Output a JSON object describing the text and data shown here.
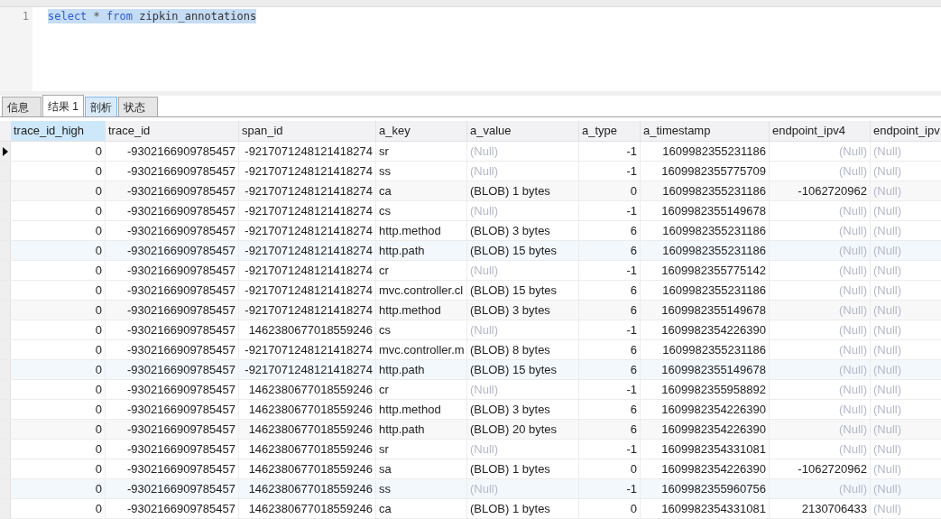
{
  "editor": {
    "lines": [
      {
        "number": "1",
        "selected": true,
        "tokens": [
          {
            "text": "select",
            "kind": "keyword"
          },
          {
            "text": "*",
            "kind": "operator"
          },
          {
            "text": "from",
            "kind": "keyword"
          },
          {
            "text": "zipkin_annotations",
            "kind": "identifier"
          }
        ]
      }
    ]
  },
  "tabs": [
    {
      "label": "信息",
      "selected": false,
      "hovered": false
    },
    {
      "label": "结果 1",
      "selected": true,
      "hovered": false
    },
    {
      "label": "剖析",
      "selected": false,
      "hovered": true
    },
    {
      "label": "状态",
      "selected": false,
      "hovered": false
    }
  ],
  "table": {
    "columns": [
      {
        "label": "trace_id_high",
        "kind": "number",
        "selected": true
      },
      {
        "label": "trace_id",
        "kind": "number",
        "selected": false
      },
      {
        "label": "span_id",
        "kind": "number",
        "selected": false
      },
      {
        "label": "a_key",
        "kind": "text",
        "selected": false
      },
      {
        "label": "a_value",
        "kind": "text",
        "selected": false
      },
      {
        "label": "a_type",
        "kind": "number",
        "selected": false
      },
      {
        "label": "a_timestamp",
        "kind": "number",
        "selected": false
      },
      {
        "label": "endpoint_ipv4",
        "kind": "number",
        "selected": false
      },
      {
        "label": "endpoint_ipv",
        "kind": "text",
        "selected": false
      }
    ],
    "rows": [
      {
        "current": true,
        "highlighted": false,
        "cells": [
          "0",
          "-9302166909785457",
          "-9217071248121418274",
          "sr",
          {
            "text": "(Null)",
            "kind": "null"
          },
          "-1",
          "1609982355231186",
          {
            "text": "(Null)",
            "kind": "null"
          },
          {
            "text": "(Null)",
            "kind": "null"
          }
        ]
      },
      {
        "current": false,
        "highlighted": false,
        "cells": [
          "0",
          "-9302166909785457",
          "-9217071248121418274",
          "ss",
          {
            "text": "(Null)",
            "kind": "null"
          },
          "-1",
          "1609982355775709",
          {
            "text": "(Null)",
            "kind": "null"
          },
          {
            "text": "(Null)",
            "kind": "null"
          }
        ]
      },
      {
        "current": false,
        "highlighted": false,
        "cells": [
          "0",
          "-9302166909785457",
          "-9217071248121418274",
          "ca",
          "(BLOB) 1 bytes",
          "0",
          "1609982355231186",
          "-1062720962",
          {
            "text": "(Null)",
            "kind": "null"
          }
        ]
      },
      {
        "current": false,
        "highlighted": false,
        "cells": [
          "0",
          "-9302166909785457",
          "-9217071248121418274",
          "cs",
          {
            "text": "(Null)",
            "kind": "null"
          },
          "-1",
          "1609982355149678",
          {
            "text": "(Null)",
            "kind": "null"
          },
          {
            "text": "(Null)",
            "kind": "null"
          }
        ]
      },
      {
        "current": false,
        "highlighted": false,
        "cells": [
          "0",
          "-9302166909785457",
          "-9217071248121418274",
          "http.method",
          "(BLOB) 3 bytes",
          "6",
          "1609982355231186",
          {
            "text": "(Null)",
            "kind": "null"
          },
          {
            "text": "(Null)",
            "kind": "null"
          }
        ]
      },
      {
        "current": false,
        "highlighted": true,
        "cells": [
          "0",
          "-9302166909785457",
          "-9217071248121418274",
          "http.path",
          "(BLOB) 15 bytes",
          "6",
          "1609982355231186",
          {
            "text": "(Null)",
            "kind": "null"
          },
          {
            "text": "(Null)",
            "kind": "null"
          }
        ]
      },
      {
        "current": false,
        "highlighted": false,
        "cells": [
          "0",
          "-9302166909785457",
          "-9217071248121418274",
          "cr",
          {
            "text": "(Null)",
            "kind": "null"
          },
          "-1",
          "1609982355775142",
          {
            "text": "(Null)",
            "kind": "null"
          },
          {
            "text": "(Null)",
            "kind": "null"
          }
        ]
      },
      {
        "current": false,
        "highlighted": false,
        "cells": [
          "0",
          "-9302166909785457",
          "-9217071248121418274",
          "mvc.controller.cl",
          "(BLOB) 15 bytes",
          "6",
          "1609982355231186",
          {
            "text": "(Null)",
            "kind": "null"
          },
          {
            "text": "(Null)",
            "kind": "null"
          }
        ]
      },
      {
        "current": false,
        "highlighted": false,
        "cells": [
          "0",
          "-9302166909785457",
          "-9217071248121418274",
          "http.method",
          "(BLOB) 3 bytes",
          "6",
          "1609982355149678",
          {
            "text": "(Null)",
            "kind": "null"
          },
          {
            "text": "(Null)",
            "kind": "null"
          }
        ]
      },
      {
        "current": false,
        "highlighted": false,
        "cells": [
          "0",
          "-9302166909785457",
          "1462380677018559246",
          "cs",
          {
            "text": "(Null)",
            "kind": "null"
          },
          "-1",
          "1609982354226390",
          {
            "text": "(Null)",
            "kind": "null"
          },
          {
            "text": "(Null)",
            "kind": "null"
          }
        ]
      },
      {
        "current": false,
        "highlighted": false,
        "cells": [
          "0",
          "-9302166909785457",
          "-9217071248121418274",
          "mvc.controller.m",
          "(BLOB) 8 bytes",
          "6",
          "1609982355231186",
          {
            "text": "(Null)",
            "kind": "null"
          },
          {
            "text": "(Null)",
            "kind": "null"
          }
        ]
      },
      {
        "current": false,
        "highlighted": true,
        "cells": [
          "0",
          "-9302166909785457",
          "-9217071248121418274",
          "http.path",
          "(BLOB) 15 bytes",
          "6",
          "1609982355149678",
          {
            "text": "(Null)",
            "kind": "null"
          },
          {
            "text": "(Null)",
            "kind": "null"
          }
        ]
      },
      {
        "current": false,
        "highlighted": false,
        "cells": [
          "0",
          "-9302166909785457",
          "1462380677018559246",
          "cr",
          {
            "text": "(Null)",
            "kind": "null"
          },
          "-1",
          "1609982355958892",
          {
            "text": "(Null)",
            "kind": "null"
          },
          {
            "text": "(Null)",
            "kind": "null"
          }
        ]
      },
      {
        "current": false,
        "highlighted": false,
        "cells": [
          "0",
          "-9302166909785457",
          "1462380677018559246",
          "http.method",
          "(BLOB) 3 bytes",
          "6",
          "1609982354226390",
          {
            "text": "(Null)",
            "kind": "null"
          },
          {
            "text": "(Null)",
            "kind": "null"
          }
        ]
      },
      {
        "current": false,
        "highlighted": false,
        "cells": [
          "0",
          "-9302166909785457",
          "1462380677018559246",
          "http.path",
          "(BLOB) 20 bytes",
          "6",
          "1609982354226390",
          {
            "text": "(Null)",
            "kind": "null"
          },
          {
            "text": "(Null)",
            "kind": "null"
          }
        ]
      },
      {
        "current": false,
        "highlighted": false,
        "cells": [
          "0",
          "-9302166909785457",
          "1462380677018559246",
          "sr",
          {
            "text": "(Null)",
            "kind": "null"
          },
          "-1",
          "1609982354331081",
          {
            "text": "(Null)",
            "kind": "null"
          },
          {
            "text": "(Null)",
            "kind": "null"
          }
        ]
      },
      {
        "current": false,
        "highlighted": false,
        "cells": [
          "0",
          "-9302166909785457",
          "1462380677018559246",
          "sa",
          "(BLOB) 1 bytes",
          "0",
          "1609982354226390",
          "-1062720962",
          {
            "text": "(Null)",
            "kind": "null"
          }
        ]
      },
      {
        "current": false,
        "highlighted": true,
        "cells": [
          "0",
          "-9302166909785457",
          "1462380677018559246",
          "ss",
          {
            "text": "(Null)",
            "kind": "null"
          },
          "-1",
          "1609982355960756",
          {
            "text": "(Null)",
            "kind": "null"
          },
          {
            "text": "(Null)",
            "kind": "null"
          }
        ]
      },
      {
        "current": false,
        "highlighted": false,
        "cells": [
          "0",
          "-9302166909785457",
          "1462380677018559246",
          "ca",
          "(BLOB) 1 bytes",
          "0",
          "1609982354331081",
          "2130706433",
          {
            "text": "(Null)",
            "kind": "null"
          }
        ]
      }
    ]
  }
}
